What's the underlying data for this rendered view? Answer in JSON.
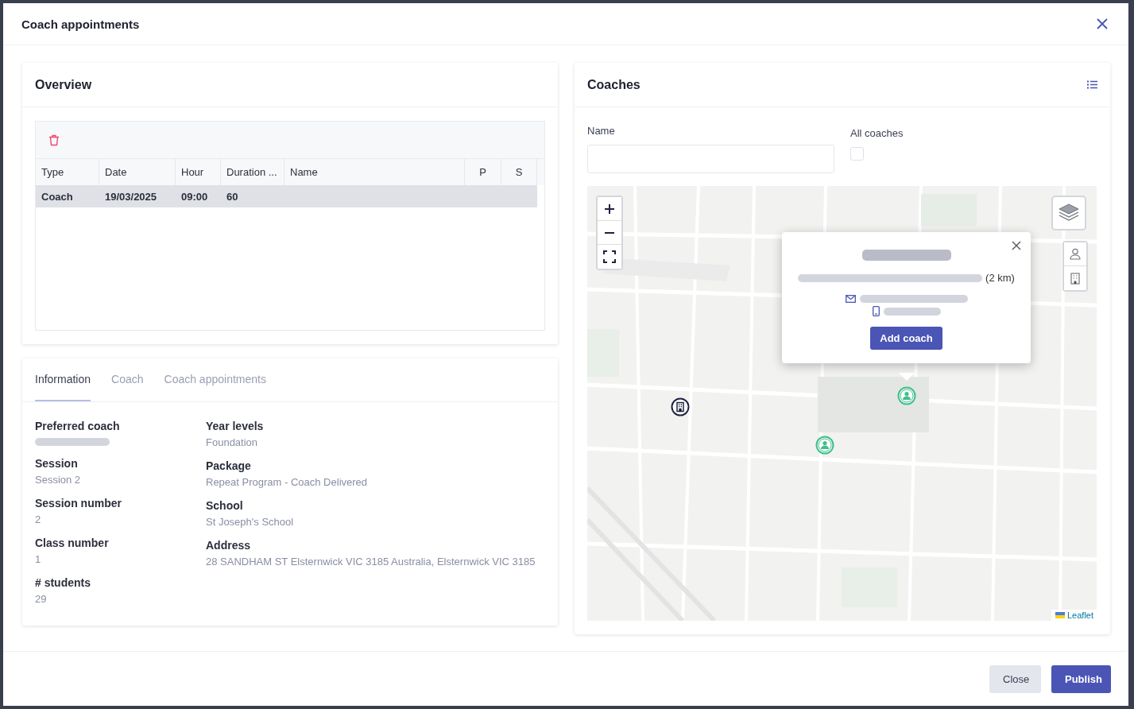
{
  "window": {
    "title": "Coach appointments"
  },
  "overview": {
    "title": "Overview",
    "table": {
      "columns": [
        "Type",
        "Date",
        "Hour",
        "Duration ...",
        "Name",
        "P",
        "S"
      ],
      "rows": [
        {
          "type": "Coach",
          "date": "19/03/2025",
          "hour": "09:00",
          "duration": "60",
          "selected": true
        }
      ]
    }
  },
  "details": {
    "tabs": [
      {
        "label": "Information",
        "selected": true
      },
      {
        "label": "Coach",
        "selected": false
      },
      {
        "label": "Coach appointments",
        "selected": false
      }
    ],
    "left_fields": [
      {
        "label": "Preferred coach",
        "redacted": true
      },
      {
        "label": "Session",
        "value": "Session 2"
      },
      {
        "label": "Session number",
        "value": "2"
      },
      {
        "label": "Class number",
        "value": "1"
      },
      {
        "label": "# students",
        "value": "29"
      }
    ],
    "right_fields": [
      {
        "label": "Year levels",
        "value": "Foundation"
      },
      {
        "label": "Package",
        "value": "Repeat Program - Coach Delivered"
      },
      {
        "label": "School",
        "value": "St Joseph's School"
      },
      {
        "label": "Address",
        "value": "28 SANDHAM ST Elsternwick VIC 3185 Australia, Elsternwick VIC 3185"
      }
    ]
  },
  "coaches": {
    "title": "Coaches",
    "name_field": {
      "label": "Name"
    },
    "all_coaches": {
      "label": "All coaches",
      "checked": false
    },
    "map": {
      "popup": {
        "distance": "(2 km)",
        "button": "Add coach"
      },
      "markers": [
        {
          "kind": "building"
        },
        {
          "kind": "person"
        },
        {
          "kind": "person"
        }
      ],
      "attribution": "Leaflet"
    }
  },
  "footer": {
    "buttons": [
      {
        "label": "Close",
        "kind": "secondary"
      },
      {
        "label": "Publish",
        "kind": "primary"
      }
    ]
  }
}
